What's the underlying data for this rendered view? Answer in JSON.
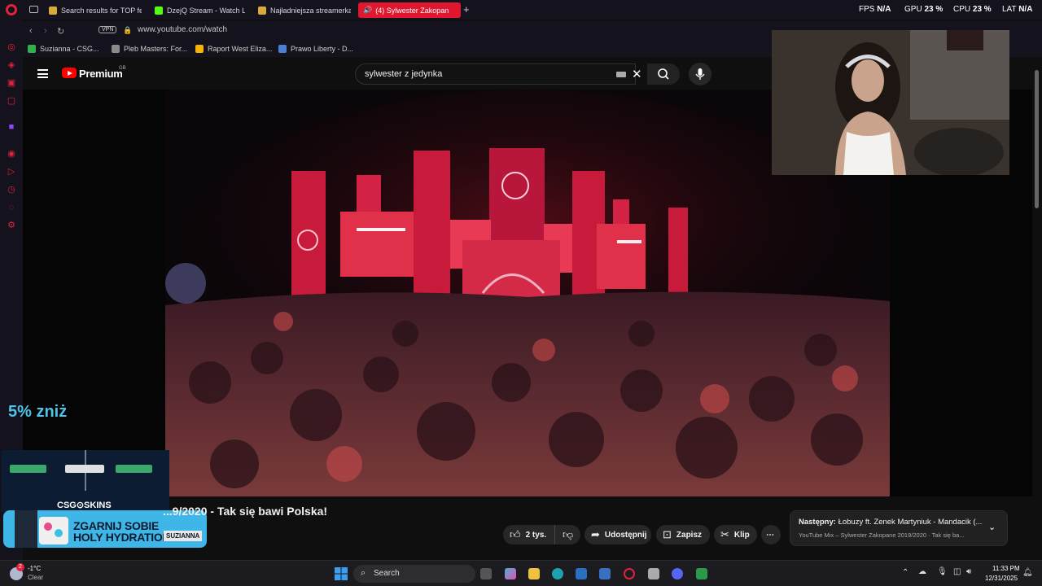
{
  "browser": {
    "tabs": [
      {
        "label": "Search results for TOP fem",
        "color": "#d8a93b"
      },
      {
        "label": "DzejQ Stream - Watch Live",
        "color": "#53fc18"
      },
      {
        "label": "Najładniejsza streamerka",
        "color": "#d8a93b"
      },
      {
        "label": "(4) Sylwester Zakopan",
        "color": "#ff0000"
      }
    ],
    "new_tab": "+",
    "stats": {
      "fps_label": "FPS",
      "fps_value": "N/A",
      "gpu_label": "GPU",
      "gpu_value": "23 %",
      "cpu_label": "CPU",
      "cpu_value": "23 %",
      "lat_label": "LAT",
      "lat_value": "N/A"
    },
    "vpn": "VPN",
    "url": "www.youtube.com/watch",
    "bookmarks": [
      {
        "label": "Suzianna - CSG...",
        "color": "#2fb24c"
      },
      {
        "label": "Pleb Masters: For...",
        "color": "#8a8a8a"
      },
      {
        "label": "Raport West Eliza...",
        "color": "#f4b400"
      },
      {
        "label": "Prawo Liberty - D...",
        "color": "#4a7fd4"
      }
    ]
  },
  "youtube": {
    "logo_text": "Premium",
    "region": "GB",
    "search_query": "sylwester z jedynka",
    "video_title": "...9/2020 - Tak się bawi Polska!",
    "actions": {
      "likes": "2 tys.",
      "share": "Udostępnij",
      "save": "Zapisz",
      "clip": "Klip",
      "more": "⋯"
    },
    "next": {
      "label": "Następny:",
      "title": "Łobuzy ft. Zenek Martyniuk - Mandacik (...",
      "subtitle": "YouTube Mix – Sylwester Zakopane 2019/2020 · Tak się ba..."
    }
  },
  "overlays": {
    "promo": "5% zniż",
    "csg_label": "CSG⊙SKINS",
    "hydration_line1": "ZGARNIJ SOBIE",
    "hydration_line2": "HOLY HYDRATION",
    "hydration_tag": "SUZIANNA"
  },
  "taskbar": {
    "weather_temp": "-1°C",
    "weather_state": "Clear",
    "weather_badge": "2",
    "search_label": "Search",
    "time": "11:33 PM",
    "date": "12/31/2025"
  }
}
